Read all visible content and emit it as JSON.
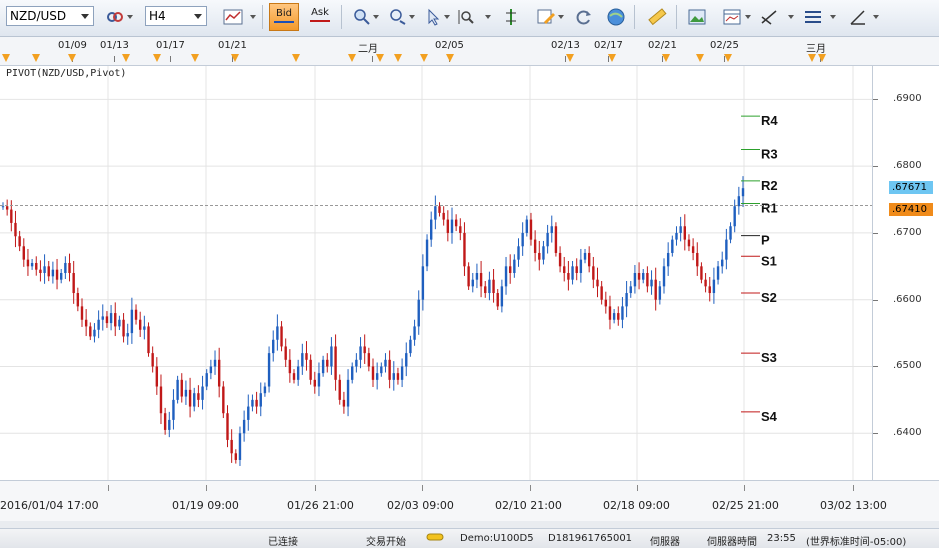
{
  "toolbar": {
    "symbol": "NZD/USD",
    "timeframe": "H4",
    "bid_label": "Bid",
    "ask_label": "Ask"
  },
  "top_axis": {
    "labels": [
      "01/09",
      "01/13",
      "01/17",
      "01/21",
      "二月",
      "02/05",
      "02/13",
      "02/17",
      "02/21",
      "02/25",
      "三月"
    ]
  },
  "chart": {
    "indicator_label": "PIVOT(NZD/USD,Pivot)",
    "pivots": [
      {
        "name": "R4",
        "value": 0.6875
      },
      {
        "name": "R3",
        "value": 0.6825
      },
      {
        "name": "R2",
        "value": 0.6778
      },
      {
        "name": "R1",
        "value": 0.6744
      },
      {
        "name": "P",
        "value": 0.6696
      },
      {
        "name": "S1",
        "value": 0.6665
      },
      {
        "name": "S2",
        "value": 0.661
      },
      {
        "name": "S3",
        "value": 0.652
      },
      {
        "name": "S4",
        "value": 0.6432
      }
    ],
    "current_ask": ".67671",
    "current_bid": ".67410",
    "y_axis_labels": [
      ".6900",
      ".6800",
      ".6700",
      ".6600",
      ".6500",
      ".6400"
    ]
  },
  "chart_data": {
    "type": "candlestick",
    "title": "PIVOT(NZD/USD,Pivot)",
    "ylim": [
      0.633,
      0.695
    ],
    "x_labels": [
      "2016/01/04 17:00",
      "01/19 09:00",
      "01/26 21:00",
      "02/03 09:00",
      "02/10 21:00",
      "02/18 09:00",
      "02/25 21:00",
      "03/02 13:00"
    ],
    "path": [
      0.674,
      0.6735,
      0.6715,
      0.6695,
      0.668,
      0.666,
      0.665,
      0.6655,
      0.6645,
      0.664,
      0.665,
      0.6635,
      0.6645,
      0.663,
      0.664,
      0.6655,
      0.664,
      0.661,
      0.659,
      0.657,
      0.656,
      0.6545,
      0.6555,
      0.657,
      0.6575,
      0.6565,
      0.658,
      0.656,
      0.657,
      0.6545,
      0.655,
      0.6585,
      0.657,
      0.6555,
      0.656,
      0.652,
      0.65,
      0.647,
      0.643,
      0.6405,
      0.642,
      0.645,
      0.648,
      0.6455,
      0.6465,
      0.644,
      0.646,
      0.645,
      0.647,
      0.649,
      0.65,
      0.651,
      0.647,
      0.643,
      0.639,
      0.637,
      0.636,
      0.64,
      0.642,
      0.644,
      0.645,
      0.644,
      0.646,
      0.647,
      0.652,
      0.654,
      0.656,
      0.653,
      0.651,
      0.649,
      0.648,
      0.65,
      0.652,
      0.651,
      0.648,
      0.647,
      0.649,
      0.651,
      0.65,
      0.653,
      0.648,
      0.645,
      0.644,
      0.648,
      0.65,
      0.651,
      0.653,
      0.652,
      0.65,
      0.648,
      0.649,
      0.65,
      0.651,
      0.648,
      0.649,
      0.648,
      0.65,
      0.652,
      0.654,
      0.656,
      0.66,
      0.665,
      0.669,
      0.672,
      0.674,
      0.673,
      0.672,
      0.67,
      0.672,
      0.671,
      0.67,
      0.665,
      0.662,
      0.663,
      0.664,
      0.662,
      0.661,
      0.663,
      0.661,
      0.659,
      0.662,
      0.665,
      0.664,
      0.666,
      0.668,
      0.67,
      0.672,
      0.669,
      0.667,
      0.666,
      0.668,
      0.67,
      0.671,
      0.667,
      0.665,
      0.664,
      0.663,
      0.665,
      0.664,
      0.666,
      0.667,
      0.665,
      0.663,
      0.662,
      0.66,
      0.659,
      0.657,
      0.658,
      0.657,
      0.659,
      0.661,
      0.662,
      0.664,
      0.663,
      0.664,
      0.662,
      0.663,
      0.66,
      0.662,
      0.665,
      0.667,
      0.669,
      0.67,
      0.671,
      0.669,
      0.668,
      0.667,
      0.665,
      0.663,
      0.662,
      0.661,
      0.663,
      0.665,
      0.666,
      0.669,
      0.671,
      0.674,
      0.6755,
      0.6767
    ]
  },
  "bottom_axis": {
    "labels": [
      "2016/01/04 17:00",
      "01/19 09:00",
      "01/26 21:00",
      "02/03 09:00",
      "02/10 21:00",
      "02/18 09:00",
      "02/25 21:00",
      "03/02 13:00"
    ]
  },
  "status": {
    "connection": "已连接",
    "trading": "交易开始",
    "account": "Demo:U100D5",
    "account_id": "D181961765001",
    "server": "伺服器",
    "server_time_label": "伺服器時間",
    "server_time": "23:55",
    "timezone": "(世界标准时间-05:00)"
  }
}
